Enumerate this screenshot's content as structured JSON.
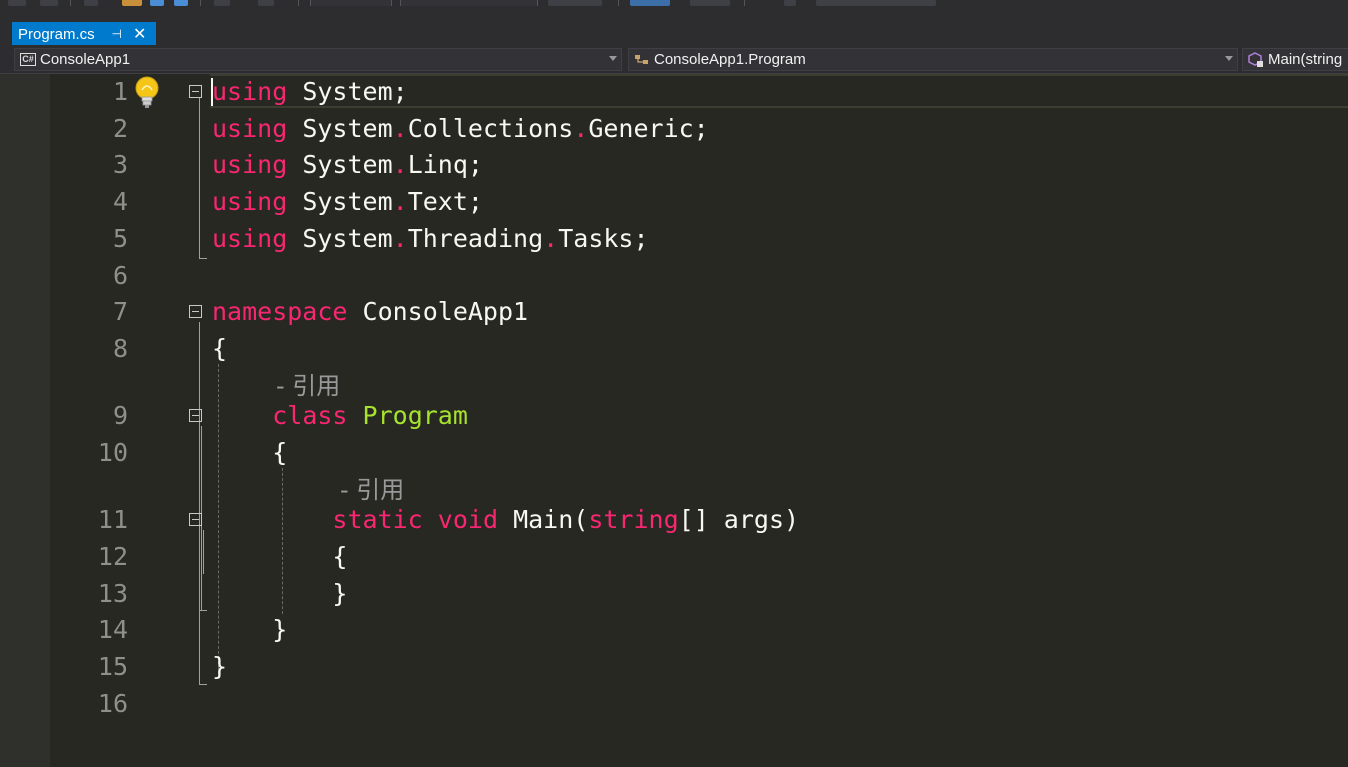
{
  "tab": {
    "title": "Program.cs",
    "pin_icon": "pin-icon",
    "close_icon": "close-icon",
    "close_glyph": "✕",
    "pin_glyph": "⊣"
  },
  "navbar": {
    "project": {
      "label": "ConsoleApp1",
      "icon": "csharp-project-icon",
      "icon_text": "C#"
    },
    "type": {
      "label": "ConsoleApp1.Program",
      "icon": "class-icon"
    },
    "member": {
      "label": "Main(string",
      "icon": "method-icon"
    }
  },
  "lens": {
    "text": "- 引用"
  },
  "lines": [
    {
      "n": "1"
    },
    {
      "n": "2"
    },
    {
      "n": "3"
    },
    {
      "n": "4"
    },
    {
      "n": "5"
    },
    {
      "n": "6"
    },
    {
      "n": "7"
    },
    {
      "n": "8"
    },
    {
      "n": "9"
    },
    {
      "n": "10"
    },
    {
      "n": "11"
    },
    {
      "n": "12"
    },
    {
      "n": "13"
    },
    {
      "n": "14"
    },
    {
      "n": "15"
    },
    {
      "n": "16"
    }
  ],
  "code": {
    "l1": [
      "using",
      " System;"
    ],
    "l2": [
      "using",
      " System",
      ".",
      "Collections",
      ".",
      "Generic;"
    ],
    "l3": [
      "using",
      " System",
      ".",
      "Linq;"
    ],
    "l4": [
      "using",
      " System",
      ".",
      "Text;"
    ],
    "l5": [
      "using",
      " System",
      ".",
      "Threading",
      ".",
      "Tasks;"
    ],
    "l7": [
      "namespace",
      " ConsoleApp1"
    ],
    "l8": [
      "{"
    ],
    "l9": [
      "    ",
      "class",
      " ",
      "Program"
    ],
    "l10": [
      "    {"
    ],
    "l11": [
      "        ",
      "static",
      " ",
      "void",
      " Main(",
      "string",
      "[] args)"
    ],
    "l12": [
      "        {"
    ],
    "l13": [
      "        }"
    ],
    "l14": [
      "    }"
    ],
    "l15": [
      "}"
    ]
  },
  "colors": {
    "keyword": "#f92672",
    "type": "#a6e22e",
    "text": "#f8f8f2",
    "linenumber": "#90908a",
    "accent": "#007acc"
  }
}
